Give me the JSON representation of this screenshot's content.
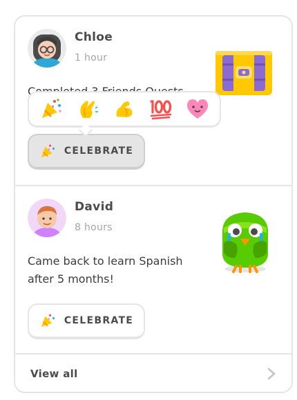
{
  "feed": {
    "posts": [
      {
        "name": "Chloe",
        "time": "1 hour",
        "message": "Completed 3 Friends Quests",
        "illustration": "treasure-chest",
        "celebrate_label": "CELEBRATE",
        "celebrate_pressed": true,
        "reactions": [
          "party-popper-icon",
          "clapping-hands-icon",
          "flexed-biceps-icon",
          "hundred-points-icon",
          "heart-face-icon"
        ]
      },
      {
        "name": "David",
        "time": "8 hours",
        "message": "Came back to learn Spanish after 5 months!",
        "illustration": "owl-mascot-crying",
        "celebrate_label": "CELEBRATE",
        "celebrate_pressed": false
      }
    ],
    "footer": {
      "label": "View all"
    }
  },
  "colors": {
    "border": "#e5e5e5",
    "text": "#4b4b4b",
    "muted": "#a5a5a5",
    "owl_green": "#58cc02",
    "chest_purple": "#8c6bd0",
    "chest_gold": "#ffc800"
  }
}
